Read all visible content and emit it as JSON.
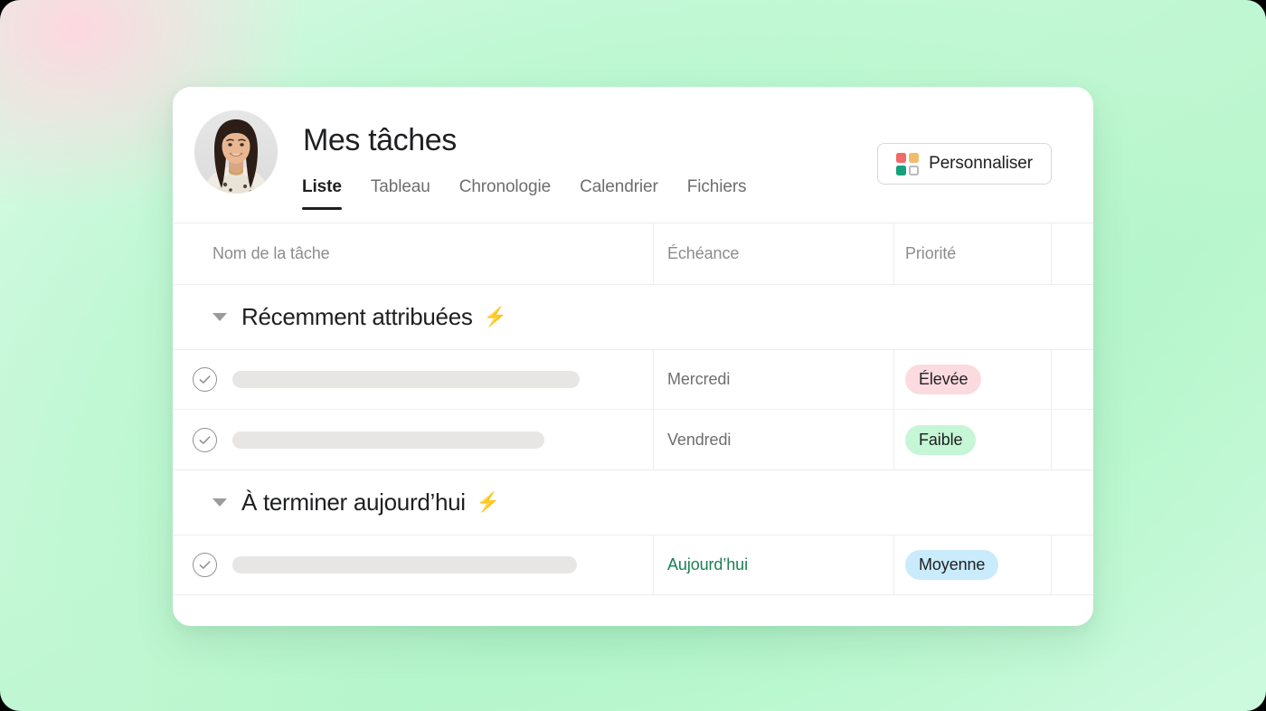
{
  "app": {
    "title": "Mes tâches",
    "avatar_name": "user-avatar"
  },
  "tabs": [
    {
      "label": "Liste",
      "active": true
    },
    {
      "label": "Tableau",
      "active": false
    },
    {
      "label": "Chronologie",
      "active": false
    },
    {
      "label": "Calendrier",
      "active": false
    },
    {
      "label": "Fichiers",
      "active": false
    }
  ],
  "customize": {
    "label": "Personnaliser",
    "icon": "color-grid-icon",
    "colors": {
      "red": "#f06a6a",
      "orange": "#f1bd6c",
      "green": "#14a07a",
      "empty_border": "#b8bcc0"
    }
  },
  "table": {
    "headers": {
      "name": "Nom de la tâche",
      "due": "Échéance",
      "priority": "Priorité"
    },
    "sections": [
      {
        "title": "Récemment attribuées",
        "badge_icon": "⚡",
        "collapsed": false,
        "rows": [
          {
            "checkbox": "check-circle-icon",
            "name_redacted_width": 384,
            "due": "Mercredi",
            "due_is_today": false,
            "priority": "Élevée",
            "priority_level": "high",
            "priority_color": "#fbdbe0"
          },
          {
            "checkbox": "check-circle-icon",
            "name_redacted_width": 345,
            "due": "Vendredi",
            "due_is_today": false,
            "priority": "Faible",
            "priority_level": "low",
            "priority_color": "#c5f6d5"
          }
        ]
      },
      {
        "title": "À terminer aujourd’hui",
        "badge_icon": "⚡",
        "collapsed": false,
        "rows": [
          {
            "checkbox": "check-circle-icon",
            "name_redacted_width": 381,
            "due": "Aujourd’hui",
            "due_is_today": true,
            "priority": "Moyenne",
            "priority_level": "medium",
            "priority_color": "#c9ebfb"
          }
        ]
      }
    ]
  },
  "theme": {
    "background_green": "#b9f6cd",
    "background_pink": "#ffd6e0",
    "card_background": "#ffffff",
    "text_primary": "#1e1f21",
    "text_muted": "#6d6e6f",
    "today_green": "#1a7f52"
  }
}
